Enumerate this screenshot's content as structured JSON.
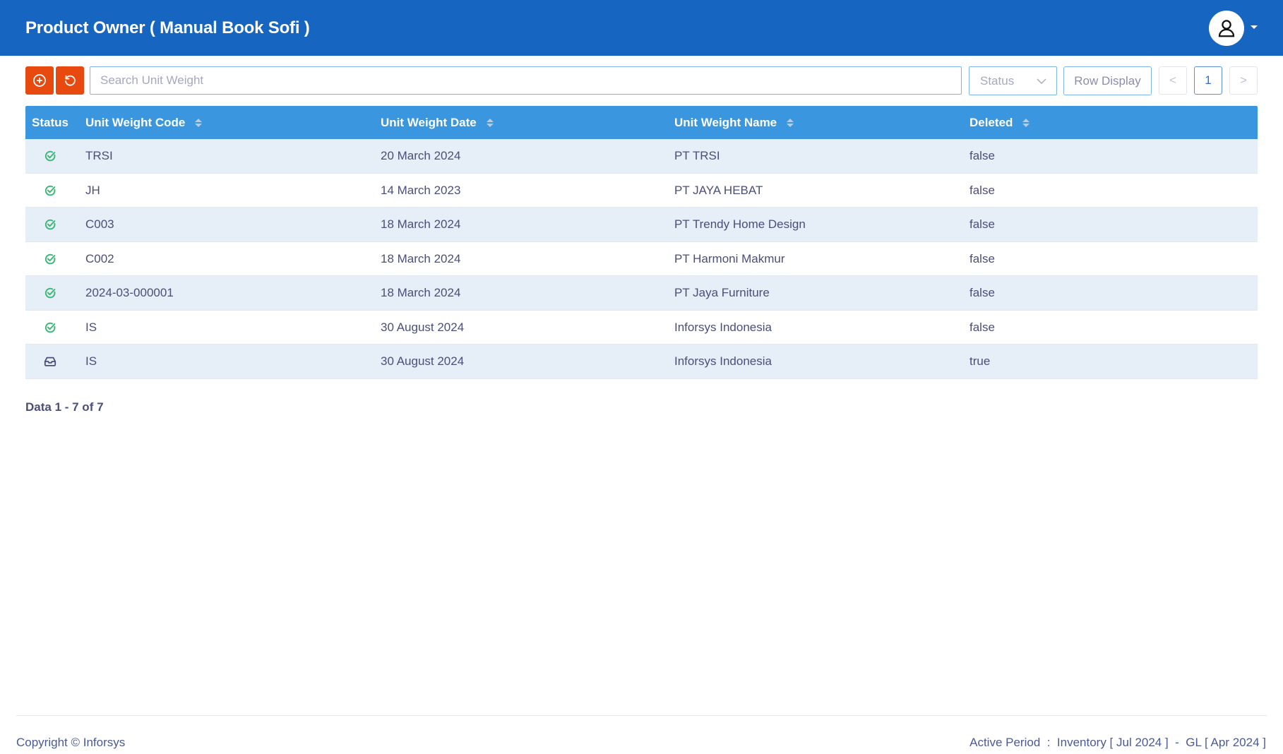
{
  "header": {
    "title": "Product Owner ( Manual Book Sofi )",
    "avatar_icon": "user-icon",
    "avatar_menu_icon": "caret-down-icon"
  },
  "toolbar": {
    "add_icon": "plus-circle-icon",
    "refresh_icon": "refresh-icon",
    "search_value": "",
    "search_placeholder": "Search Unit Weight",
    "status_placeholder": "Status",
    "status_icon": "chevron-down-icon",
    "row_display_label": "Row Display",
    "pagination": {
      "prev": "<",
      "current": "1",
      "next": ">"
    }
  },
  "table": {
    "columns": [
      {
        "label": "Status",
        "sortable": false
      },
      {
        "label": "Unit Weight Code",
        "sortable": true
      },
      {
        "label": "Unit Weight Date",
        "sortable": true
      },
      {
        "label": "Unit Weight Name",
        "sortable": true
      },
      {
        "label": "Deleted",
        "sortable": true
      }
    ],
    "rows": [
      {
        "status": "active",
        "status_icon": "check-circle-icon",
        "code": "TRSI",
        "date": "20 March 2024",
        "name": "PT TRSI",
        "deleted": "false"
      },
      {
        "status": "active",
        "status_icon": "check-circle-icon",
        "code": "JH",
        "date": "14 March 2023",
        "name": "PT JAYA HEBAT",
        "deleted": "false"
      },
      {
        "status": "active",
        "status_icon": "check-circle-icon",
        "code": "C003",
        "date": "18 March 2024",
        "name": "PT Trendy Home Design",
        "deleted": "false"
      },
      {
        "status": "active",
        "status_icon": "check-circle-icon",
        "code": "C002",
        "date": "18 March 2024",
        "name": "PT Harmoni Makmur",
        "deleted": "false"
      },
      {
        "status": "active",
        "status_icon": "check-circle-icon",
        "code": "2024-03-000001",
        "date": "18 March 2024",
        "name": "PT Jaya Furniture",
        "deleted": "false"
      },
      {
        "status": "active",
        "status_icon": "check-circle-icon",
        "code": "IS",
        "date": "30 August 2024",
        "name": "Inforsys Indonesia",
        "deleted": "false"
      },
      {
        "status": "archived",
        "status_icon": "inbox-icon",
        "code": "IS",
        "date": "30 August 2024",
        "name": "Inforsys Indonesia",
        "deleted": "true"
      }
    ]
  },
  "summary": "Data 1 - 7 of 7",
  "footer": {
    "copyright": "Copyright © Inforsys",
    "active_period": "Active Period  :  Inventory [ Jul 2024 ]  -  GL [ Apr 2024 ]"
  },
  "colors": {
    "topbar": "#1665c1",
    "table_header": "#3a96de",
    "action_button": "#e8490f",
    "row_alt": "#e6eef8",
    "status_active": "#3cb878",
    "status_archived": "#4a4f7a"
  }
}
